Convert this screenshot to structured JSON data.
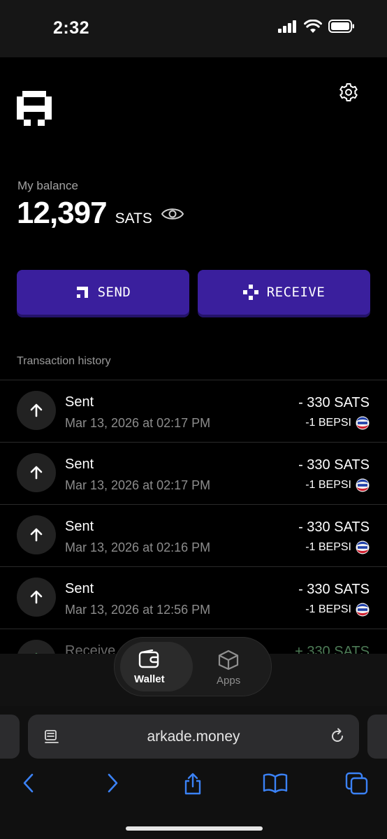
{
  "status": {
    "time": "2:32",
    "icons": [
      "cellular-signal-icon",
      "wifi-icon",
      "battery-icon"
    ]
  },
  "header": {
    "logo": "arkade-logo",
    "settings_icon": "gear-icon"
  },
  "balance": {
    "label": "My balance",
    "value": "12,397",
    "unit": "SATS",
    "visibility_icon": "eye-icon"
  },
  "actions": {
    "send_label": "SEND",
    "receive_label": "RECEIVE"
  },
  "history": {
    "label": "Transaction history",
    "items": [
      {
        "title": "Sent",
        "date": "Mar 13, 2026 at 02:17 PM",
        "amount": "- 330 SATS",
        "token": "-1 BEPSI",
        "icon": "arrow-up-icon"
      },
      {
        "title": "Sent",
        "date": "Mar 13, 2026 at 02:17 PM",
        "amount": "- 330 SATS",
        "token": "-1 BEPSI",
        "icon": "arrow-up-icon"
      },
      {
        "title": "Sent",
        "date": "Mar 13, 2026 at 02:16 PM",
        "amount": "- 330 SATS",
        "token": "-1 BEPSI",
        "icon": "arrow-up-icon"
      },
      {
        "title": "Sent",
        "date": "Mar 13, 2026 at 12:56 PM",
        "amount": "- 330 SATS",
        "token": "-1 BEPSI",
        "icon": "arrow-up-icon"
      },
      {
        "title": "Receive",
        "date": "",
        "amount": "+ 330 SATS",
        "token": "",
        "icon": "arrow-down-icon"
      }
    ]
  },
  "nav": {
    "wallet_label": "Wallet",
    "apps_label": "Apps"
  },
  "browser": {
    "url": "arkade.money"
  },
  "colors": {
    "accent": "#3a1f9d",
    "background": "#000000",
    "received": "#4c7a55",
    "browser_icons": "#3b82f6"
  }
}
